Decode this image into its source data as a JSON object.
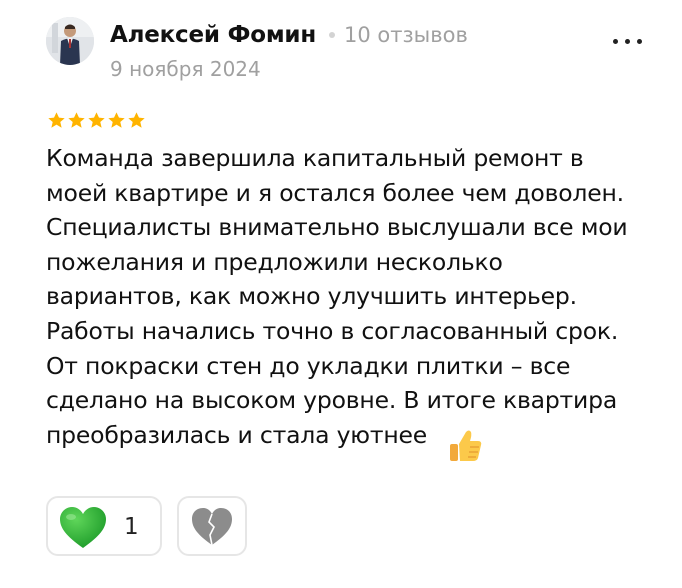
{
  "review": {
    "author": {
      "name": "Алексей Фомин",
      "reviews_count": "10 отзывов",
      "avatar": "user-photo"
    },
    "date": "9 ноября 2024",
    "rating": 5,
    "rating_max": 5,
    "text": "Команда завершила капитальный ремонт в\nмоей квартире и я остался более чем доволен.\nСпециалисты внимательно выслушали все мои\nпожелания и предложили несколько\nвариантов, как можно улучшить интерьер.\nРаботы начались точно в согласованный срок.\nОт покраски стен до укладки плитки – все\nсделано на высоком уровне. В итоге квартира\nпреобразилась и стала уютнее",
    "text_emoji": "thumbs-up-emoji",
    "reactions": {
      "like": {
        "icon": "green-heart-icon",
        "count": "1",
        "color": "#2bb236"
      },
      "dislike": {
        "icon": "broken-heart-icon",
        "color": "#8c8c8c"
      }
    },
    "menu_icon": "more-dots-icon",
    "star_color": "#ffb400"
  }
}
